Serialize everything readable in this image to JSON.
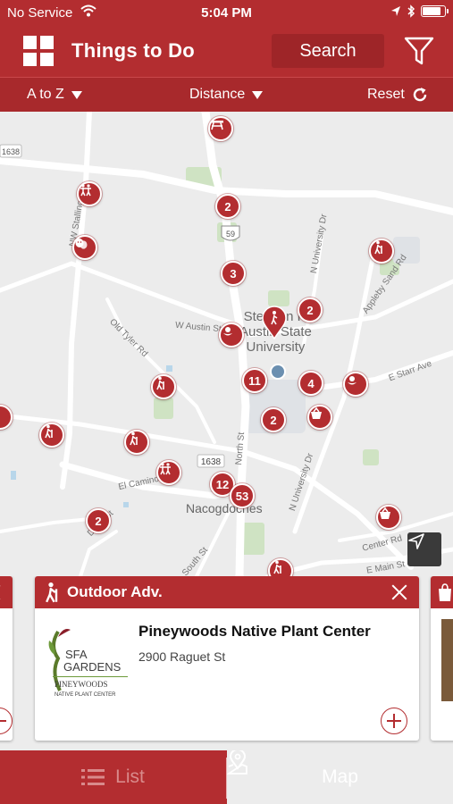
{
  "status_bar": {
    "carrier": "No Service",
    "time": "5:04 PM",
    "battery_level": 0.85
  },
  "header": {
    "title": "Things to Do",
    "search_label": "Search",
    "menu_icon": "grid-icon",
    "filter_icon": "filter-icon"
  },
  "sort_bar": {
    "sort_label": "A to Z",
    "distance_label": "Distance",
    "reset_label": "Reset"
  },
  "map": {
    "road_labels": [
      "NW Stallings Dr",
      "Old Tyler Rd",
      "W Austin St",
      "N University Dr",
      "Appleby Sand Rd",
      "E Starr Ave",
      "North St",
      "El Camino Real",
      "N University Dr",
      "South St",
      "Center Rd",
      "E Main St",
      "Durst St"
    ],
    "shields": [
      "1638",
      "59",
      "1638"
    ],
    "place_labels": {
      "university_line1": "Stephen F.",
      "university_line2": "Austin State",
      "university_line3": "University",
      "city": "Nacogdoches"
    },
    "cluster_counts": [
      "2",
      "3",
      "2",
      "11",
      "4",
      "2",
      "12",
      "53",
      "2"
    ]
  },
  "cards": {
    "main": {
      "category": "Outdoor Adv.",
      "name": "Pineywoods Native Plant Center",
      "address": "2900 Raguet St",
      "logo_lines": [
        "SFA",
        "GARDENS",
        "PINEYWOODS",
        "NATIVE PLANT CENTER"
      ]
    }
  },
  "bottom_nav": {
    "list_label": "List",
    "map_label": "Map",
    "active": "Map"
  },
  "colors": {
    "brand": "#b32d30",
    "brand_dark": "#9e2528",
    "map_bg": "#ececec"
  }
}
